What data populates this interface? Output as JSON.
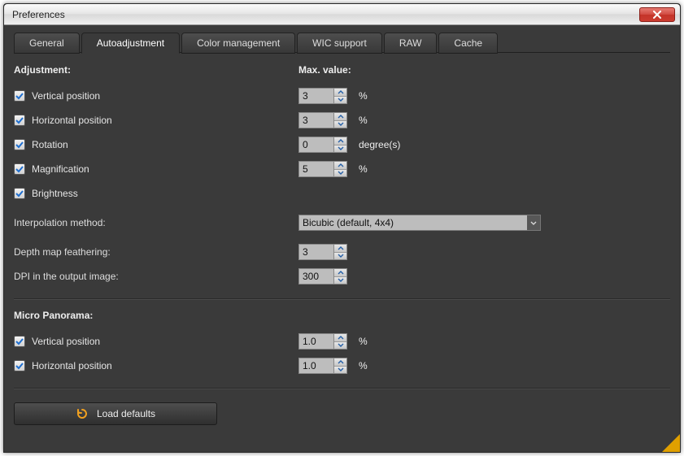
{
  "window": {
    "title": "Preferences"
  },
  "tabs": [
    "General",
    "Autoadjustment",
    "Color management",
    "WIC support",
    "RAW",
    "Cache"
  ],
  "active_tab_index": 1,
  "colors": {
    "accent_check": "#1f6fd0"
  },
  "section": {
    "heading_left": "Adjustment:",
    "heading_right": "Max. value:",
    "items": [
      {
        "label": "Vertical position",
        "checked": true,
        "value": "3",
        "unit": "%"
      },
      {
        "label": "Horizontal position",
        "checked": true,
        "value": "3",
        "unit": "%"
      },
      {
        "label": "Rotation",
        "checked": true,
        "value": "0",
        "unit": "degree(s)"
      },
      {
        "label": "Magnification",
        "checked": true,
        "value": "5",
        "unit": "%"
      },
      {
        "label": "Brightness",
        "checked": true
      }
    ],
    "interp_label": "Interpolation method:",
    "interp_value": "Bicubic (default, 4x4)",
    "feather_label": "Depth map feathering:",
    "feather_value": "3",
    "dpi_label": "DPI in the output image:",
    "dpi_value": "300"
  },
  "micro": {
    "heading": "Micro Panorama:",
    "items": [
      {
        "label": "Vertical position",
        "checked": true,
        "value": "1.0",
        "unit": "%"
      },
      {
        "label": "Horizontal position",
        "checked": true,
        "value": "1.0",
        "unit": "%"
      }
    ]
  },
  "buttons": {
    "load_defaults": "Load defaults"
  }
}
